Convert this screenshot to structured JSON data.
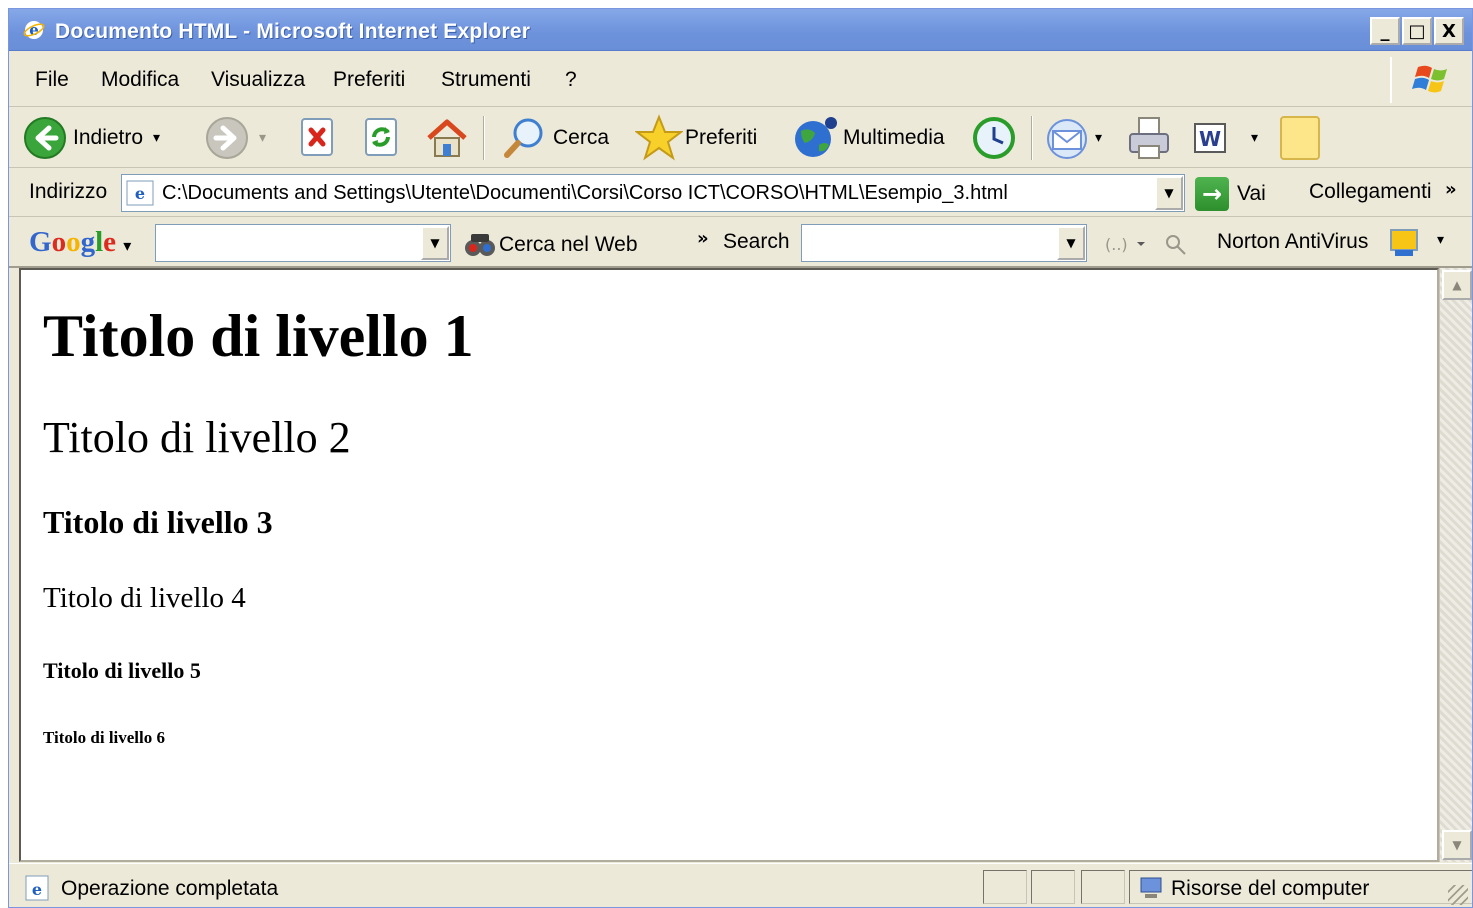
{
  "window": {
    "title": "Documento HTML - Microsoft Internet Explorer",
    "controls": {
      "minimize": "_",
      "maximize": "□",
      "close": "X"
    }
  },
  "menu": {
    "items": [
      "File",
      "Modifica",
      "Visualizza",
      "Preferiti",
      "Strumenti",
      "?"
    ]
  },
  "toolbar": {
    "back_label": "Indietro",
    "search_label": "Cerca",
    "favorites_label": "Preferiti",
    "media_label": "Multimedia",
    "dropdown_glyph": "▾"
  },
  "address": {
    "label": "Indirizzo",
    "url": "C:\\Documents and Settings\\Utente\\Documenti\\Corsi\\Corso ICT\\CORSO\\HTML\\Esempio_3.html",
    "go_label": "Vai",
    "links_label": "Collegamenti",
    "chevron": "»"
  },
  "google_bar": {
    "logo_parts": [
      "G",
      "o",
      "o",
      "g",
      "l",
      "e"
    ],
    "menu_arrow": "▾",
    "search_web_label": "Cerca nel Web",
    "chevron": "»",
    "search_label": "Search",
    "norton_label": "Norton AntiVirus"
  },
  "content": {
    "h1": "Titolo di livello 1",
    "h2": "Titolo di livello 2",
    "h3": "Titolo di livello 3",
    "h4": "Titolo di livello 4",
    "h5": "Titolo di livello 5",
    "h6": "Titolo di livello 6"
  },
  "status": {
    "text": "Operazione completata",
    "zone": "Risorse del computer"
  },
  "colors": {
    "titlebar": "#6d92dc",
    "chrome": "#ece9d8",
    "go_green": "#2d8f2d",
    "google_blue": "#3366cc",
    "google_red": "#dd2b1f",
    "google_yellow": "#f4b400",
    "google_green": "#2a9c2a"
  }
}
